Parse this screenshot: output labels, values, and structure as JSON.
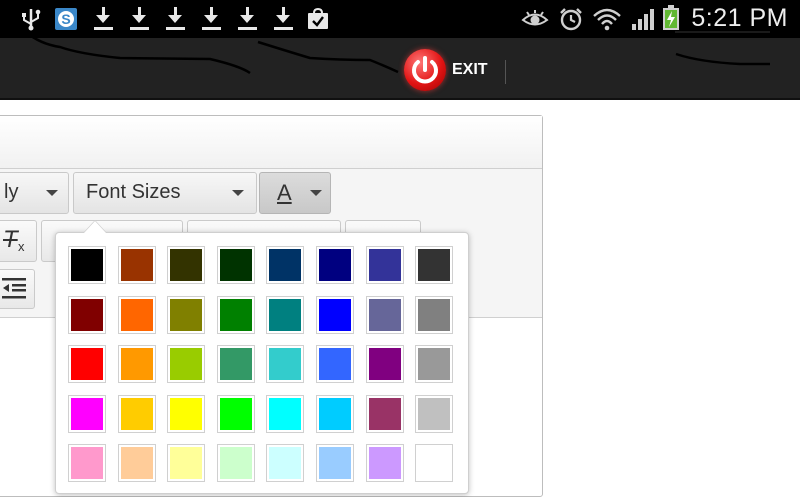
{
  "status_bar": {
    "time": "5:21 PM",
    "icons": [
      "usb-icon",
      "s-app-icon",
      "download-icon",
      "download-icon",
      "download-icon",
      "download-icon",
      "download-icon",
      "shopping-bag-check-icon",
      "eye-icon",
      "alarm-icon",
      "wifi-icon",
      "signal-icon",
      "battery-charging-icon"
    ]
  },
  "action_bar": {
    "exit_label": "EXIT"
  },
  "toolbar": {
    "font_family_label": "ly",
    "font_sizes_label": "Font Sizes",
    "font_color_letter": "A",
    "clear_format_letter": "T",
    "clear_format_sub": "x"
  },
  "color_palette": {
    "rows": [
      [
        "#000000",
        "#993300",
        "#333300",
        "#003300",
        "#003366",
        "#000080",
        "#333399",
        "#333333"
      ],
      [
        "#800000",
        "#ff6600",
        "#808000",
        "#008000",
        "#008080",
        "#0000ff",
        "#666699",
        "#808080"
      ],
      [
        "#ff0000",
        "#ff9900",
        "#99cc00",
        "#339966",
        "#33cccc",
        "#3366ff",
        "#800080",
        "#999999"
      ],
      [
        "#ff00ff",
        "#ffcc00",
        "#ffff00",
        "#00ff00",
        "#00ffff",
        "#00ccff",
        "#993366",
        "#c0c0c0"
      ],
      [
        "#ff99cc",
        "#ffcc99",
        "#ffff99",
        "#ccffcc",
        "#ccffff",
        "#99ccff",
        "#cc99ff",
        "#ffffff"
      ]
    ]
  },
  "colors": {
    "status_bar_bg": "#000000",
    "action_bar_bg": "#222222",
    "exit_red": "#e21414"
  }
}
